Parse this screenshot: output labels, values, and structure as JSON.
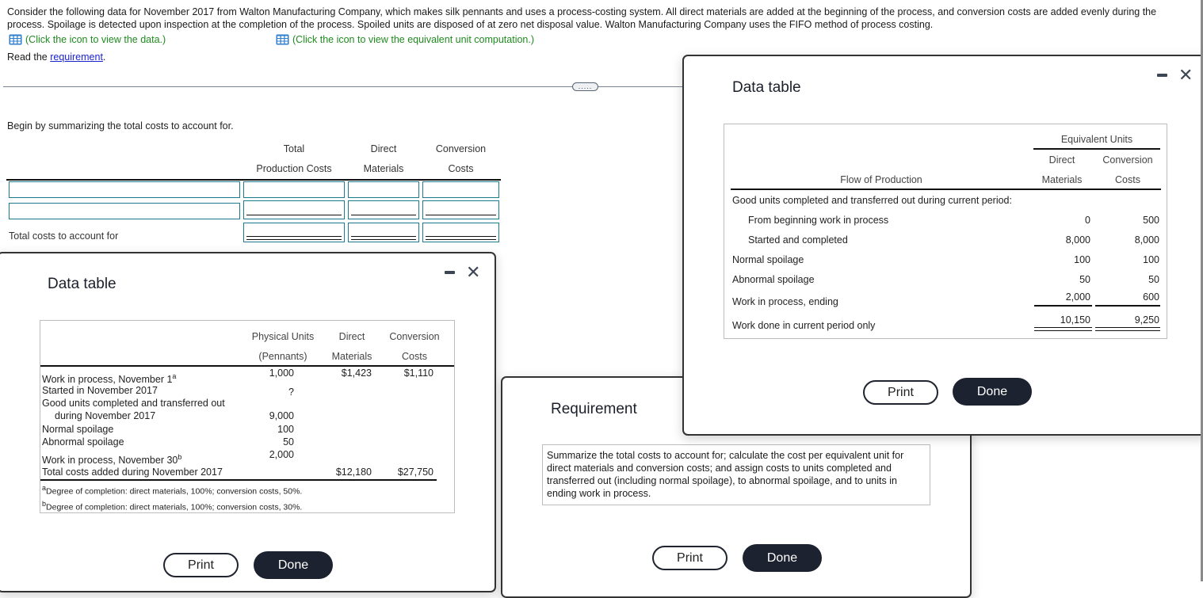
{
  "intro": {
    "text": "Consider the following data for November 2017 from Walton Manufacturing Company, which makes silk pennants and uses a process-costing system. All direct materials are added at the beginning of the process, and conversion costs are added evenly during the process. Spoilage is detected upon inspection at the completion of the process. Spoiled units are disposed of at zero net disposal value. Walton Manufacturing Company uses the FIFO method of process costing.",
    "data_link": "(Click the icon to view the data.)",
    "equiv_link": "(Click the icon to view the equivalent unit computation.)",
    "read_prefix": "Read the ",
    "read_link": "requirement",
    "read_suffix": ".",
    "link_icon": "table-grid-icon",
    "expander_label": "....."
  },
  "worksheet": {
    "instruction": "Begin by summarizing the total costs to account for.",
    "headers": {
      "total_line1": "Total",
      "total_line2": "Production Costs",
      "dm_line1": "Direct",
      "dm_line2": "Materials",
      "cc_line1": "Conversion",
      "cc_line2": "Costs"
    },
    "rows": [
      {
        "label_input": "",
        "total": "",
        "dm": "",
        "cc": ""
      },
      {
        "label_input": "",
        "total": "",
        "dm": "",
        "cc": ""
      }
    ],
    "total_row_label": "Total costs to account for",
    "total_row": {
      "total": "",
      "dm": "",
      "cc": ""
    }
  },
  "data_dialog_1": {
    "title": "Data table",
    "minimize_icon": "minimize-icon",
    "close_icon": "close-icon",
    "headers": {
      "pu_line1": "Physical Units",
      "pu_line2": "(Pennants)",
      "dm_line1": "Direct",
      "dm_line2": "Materials",
      "cc_line1": "Conversion",
      "cc_line2": "Costs"
    },
    "rows": [
      {
        "label": "Work in process, November 1",
        "sup": "a",
        "units": "1,000",
        "dm": "$1,423",
        "cc": "$1,110"
      },
      {
        "label": "Started in November 2017",
        "sup": "",
        "units": "?",
        "dm": "",
        "cc": ""
      },
      {
        "label": "Good units completed and transferred out",
        "sup": "",
        "units": "",
        "dm": "",
        "cc": ""
      },
      {
        "label": "during November 2017",
        "sup": "",
        "units": "9,000",
        "dm": "",
        "cc": ""
      },
      {
        "label": "Normal spoilage",
        "sup": "",
        "units": "100",
        "dm": "",
        "cc": ""
      },
      {
        "label": "Abnormal spoilage",
        "sup": "",
        "units": "50",
        "dm": "",
        "cc": ""
      },
      {
        "label": "Work in process, November 30",
        "sup": "b",
        "units": "2,000",
        "dm": "",
        "cc": ""
      },
      {
        "label": "Total costs added during November 2017",
        "sup": "",
        "units": "",
        "dm": "$12,180",
        "cc": "$27,750"
      }
    ],
    "footnotes": [
      {
        "mark": "a",
        "text": "Degree of completion: direct materials, 100%; conversion costs, 50%."
      },
      {
        "mark": "b",
        "text": "Degree of completion: direct materials, 100%; conversion costs, 30%."
      }
    ],
    "print_label": "Print",
    "done_label": "Done"
  },
  "data_dialog_2": {
    "title": "Data table",
    "minimize_icon": "minimize-icon",
    "close_icon": "close-icon",
    "headers": {
      "group": "Equivalent Units",
      "flow": "Flow of Production",
      "dm_line1": "Direct",
      "dm_line2": "Materials",
      "cc_line1": "Conversion",
      "cc_line2": "Costs"
    },
    "rows": [
      {
        "label": "Good units completed and transferred out during current period:",
        "indent": false,
        "dm": "",
        "cc": ""
      },
      {
        "label": "From beginning work in process",
        "indent": true,
        "dm": "0",
        "cc": "500"
      },
      {
        "label": "Started and completed",
        "indent": true,
        "dm": "8,000",
        "cc": "8,000"
      },
      {
        "label": "Normal spoilage",
        "indent": false,
        "dm": "100",
        "cc": "100"
      },
      {
        "label": "Abnormal spoilage",
        "indent": false,
        "dm": "50",
        "cc": "50"
      },
      {
        "label": "Work in process, ending",
        "indent": false,
        "dm": "2,000",
        "cc": "600"
      },
      {
        "label": "Work done in current period only",
        "indent": false,
        "dm": "10,150",
        "cc": "9,250"
      }
    ],
    "print_label": "Print",
    "done_label": "Done"
  },
  "requirement_dialog": {
    "title": "Requirement",
    "text": "Summarize the total costs to account for; calculate the cost per equivalent unit for direct materials and conversion costs; and assign costs to units completed and transferred out (including normal spoilage), to abnormal spoilage, and to units in ending work in process.",
    "print_label": "Print",
    "done_label": "Done"
  }
}
